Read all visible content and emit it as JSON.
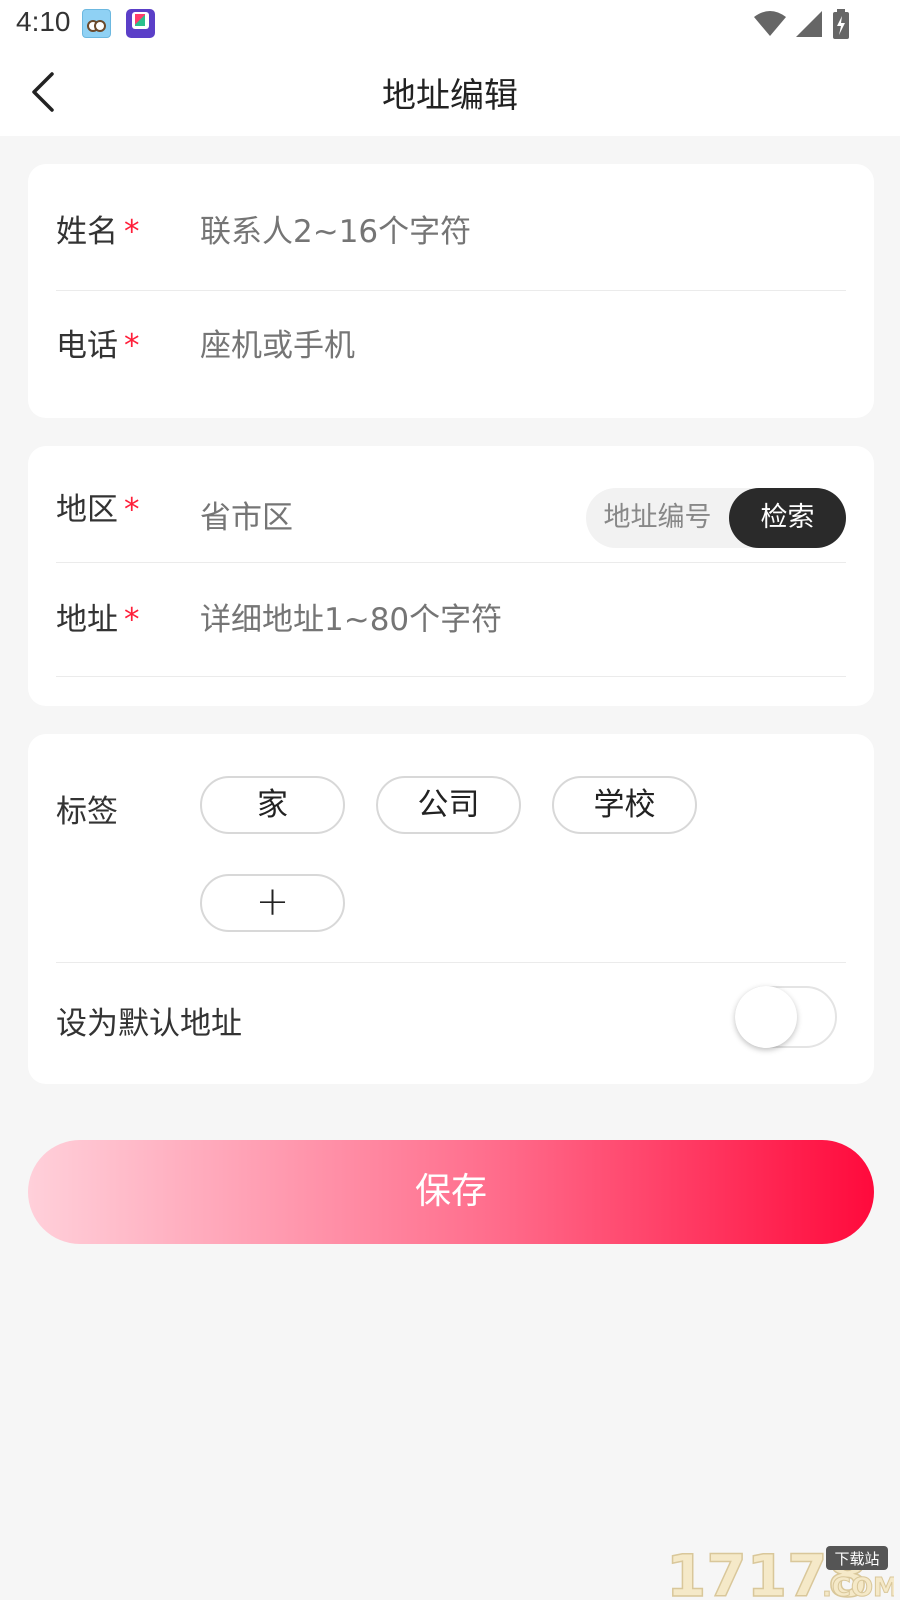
{
  "status_bar": {
    "time": "4:10",
    "app_icons": [
      "cartoon-face-icon",
      "k-app-icon"
    ],
    "indicators": [
      "wifi-icon",
      "signal-icon",
      "battery-charging-icon"
    ]
  },
  "header": {
    "back_icon": "chevron-left-icon",
    "title": "地址编辑"
  },
  "contact_card": {
    "name_label": "姓名",
    "name_required": "*",
    "name_placeholder": "联系人2~16个字符",
    "phone_label": "电话",
    "phone_required": "*",
    "phone_placeholder": "座机或手机"
  },
  "address_card": {
    "region_label": "地区",
    "region_required": "*",
    "region_placeholder": "省市区",
    "lookup_toggle": {
      "option_code": "地址编号",
      "option_search": "检索",
      "selected": "检索"
    },
    "address_label": "地址",
    "address_required": "*",
    "address_placeholder": "详细地址1~80个字符"
  },
  "tag_card": {
    "tags_label": "标签",
    "tags": [
      "家",
      "公司",
      "学校"
    ],
    "add_tag": "+",
    "default_label": "设为默认地址",
    "default_enabled": false
  },
  "save_label": "保存",
  "colors": {
    "required": "#ff1f3a",
    "accent_start": "#ffd0da",
    "accent_end": "#ff0a3c",
    "selected_segment": "#2a2a2a"
  }
}
